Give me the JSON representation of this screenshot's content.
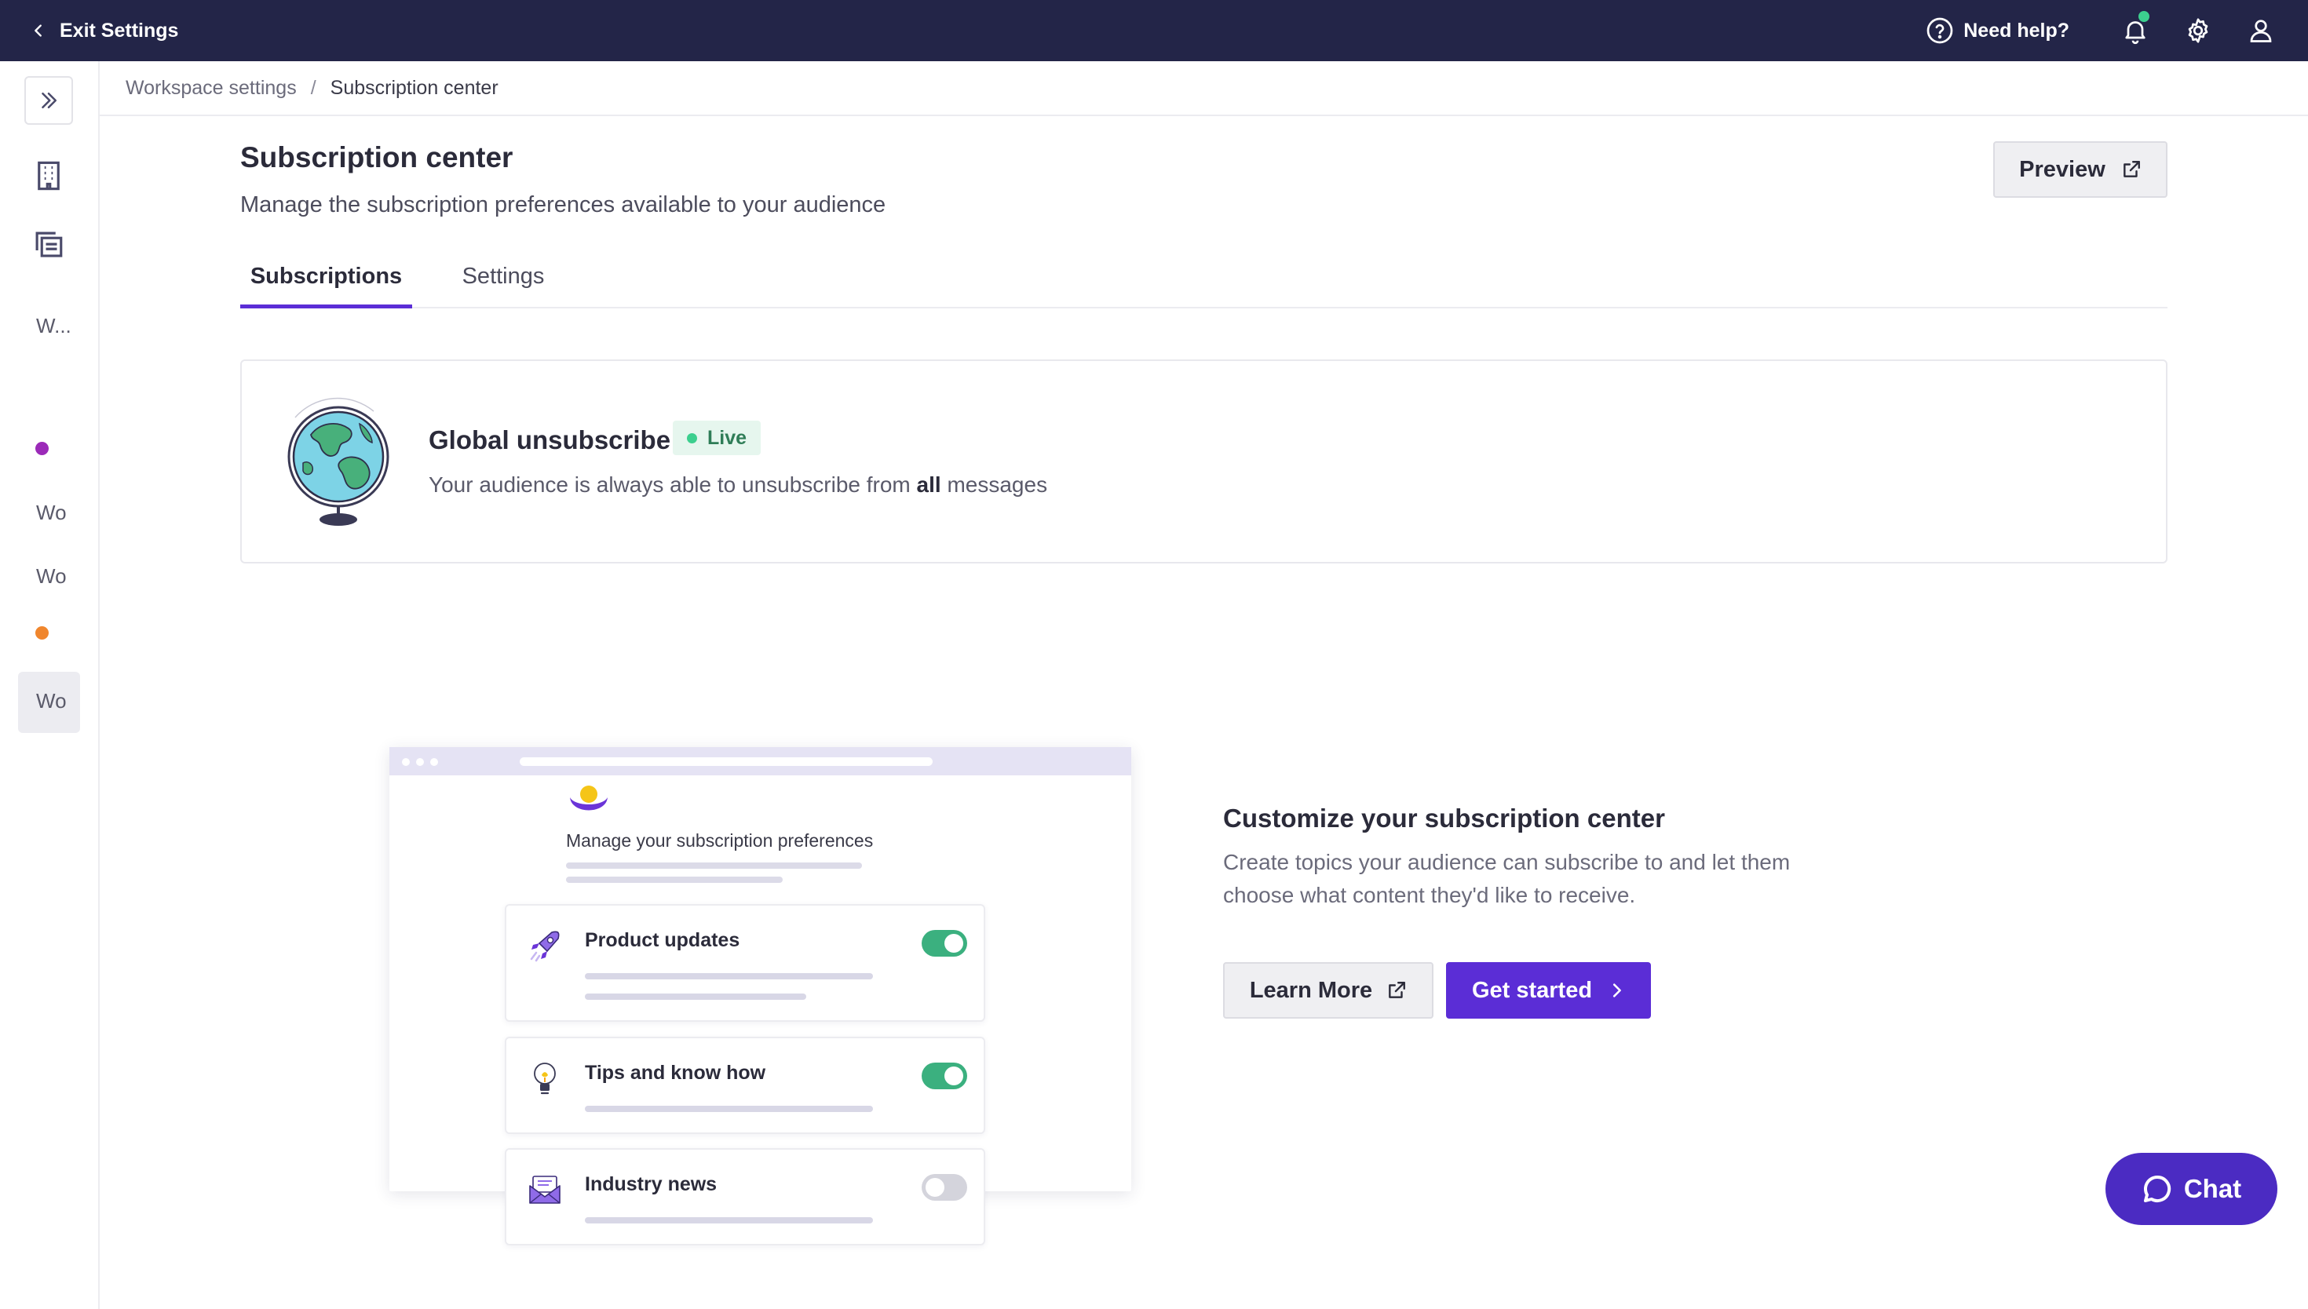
{
  "topbar": {
    "exit_label": "Exit Settings",
    "help_label": "Need help?",
    "icons": [
      "chevron-left-icon",
      "help-circle-icon",
      "bell-icon",
      "gear-icon",
      "user-icon"
    ],
    "bar_color": "#232548",
    "notification_dot_color": "#3ccf8e"
  },
  "rail": {
    "icons": [
      "chevrons-right-icon",
      "building-icon",
      "copy-list-icon"
    ],
    "items": [
      {
        "label": "W..."
      },
      {
        "label": "Wo"
      },
      {
        "label": "Wo"
      },
      {
        "label": "Wo"
      }
    ],
    "dot_colors": [
      "#9b2ab8",
      "#f0862d"
    ]
  },
  "breadcrumb": {
    "parent": "Workspace settings",
    "separator": "/",
    "current": "Subscription center"
  },
  "header": {
    "title": "Subscription center",
    "subtitle": "Manage the subscription preferences available to your audience",
    "preview_label": "Preview"
  },
  "tabs": [
    {
      "label": "Subscriptions",
      "active": true
    },
    {
      "label": "Settings",
      "active": false
    }
  ],
  "global_unsubscribe": {
    "title": "Global unsubscribe",
    "status": "Live",
    "desc_before": "Your audience is always able to unsubscribe from ",
    "desc_bold": "all",
    "desc_after": " messages"
  },
  "illustration": {
    "heading": "Manage your subscription preferences",
    "preferences": [
      {
        "label": "Product updates",
        "icon": "rocket-icon",
        "enabled": true
      },
      {
        "label": "Tips and know how",
        "icon": "lightbulb-icon",
        "enabled": true
      },
      {
        "label": "Industry news",
        "icon": "envelope-icon",
        "enabled": false
      }
    ]
  },
  "customize": {
    "title": "Customize your subscription center",
    "description": "Create topics your audience can subscribe to and let them choose what content they'd like to receive.",
    "learn_more_label": "Learn More",
    "get_started_label": "Get started"
  },
  "chat": {
    "label": "Chat"
  },
  "colors": {
    "accent": "#5b2dd6",
    "live_green": "#3ccf8e",
    "toggle_on": "#3bb07f"
  }
}
